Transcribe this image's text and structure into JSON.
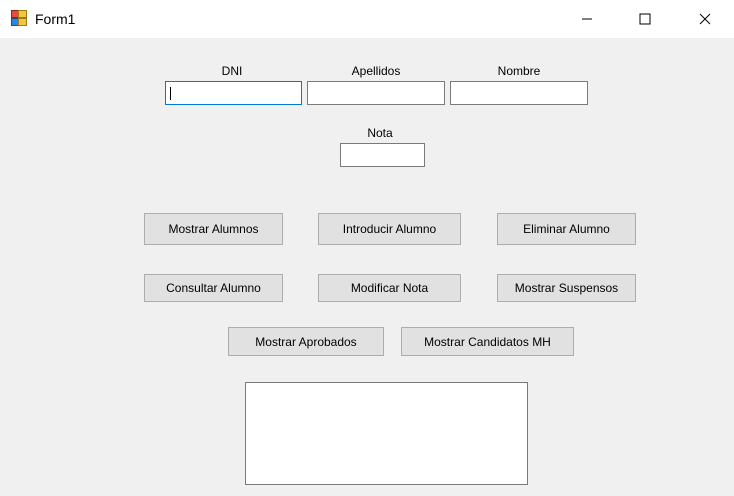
{
  "window": {
    "title": "Form1",
    "app_icon": "winforms-app-icon",
    "controls": {
      "minimize_icon": "minimize-icon",
      "maximize_icon": "maximize-icon",
      "close_icon": "close-icon"
    }
  },
  "form": {
    "labels": {
      "dni": "DNI",
      "apellidos": "Apellidos",
      "nombre": "Nombre",
      "nota": "Nota"
    },
    "fields": {
      "dni": {
        "value": "",
        "placeholder": "",
        "focused": true
      },
      "apellidos": {
        "value": "",
        "placeholder": ""
      },
      "nombre": {
        "value": "",
        "placeholder": ""
      },
      "nota": {
        "value": "",
        "placeholder": ""
      }
    },
    "buttons": {
      "mostrar_alumnos": "Mostrar Alumnos",
      "introducir_alumno": "Introducir Alumno",
      "eliminar_alumno": "Eliminar Alumno",
      "consultar_alumno": "Consultar Alumno",
      "modificar_nota": "Modificar Nota",
      "mostrar_suspensos": "Mostrar Suspensos",
      "mostrar_aprobados": "Mostrar Aprobados",
      "mostrar_candidatos_mh": "Mostrar Candidatos MH"
    },
    "output": {
      "text": ""
    }
  },
  "colors": {
    "form_background": "#f0f0f0",
    "button_face": "#e1e1e1",
    "focus_border": "#0078d7"
  }
}
